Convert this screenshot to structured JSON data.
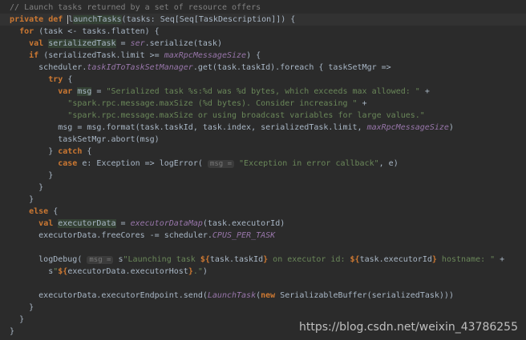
{
  "editor": {
    "lines": [
      [
        {
          "t": "  // Launch tasks returned by a set of resource offers",
          "c": "comment"
        }
      ],
      [
        {
          "t": "  ",
          "c": "plain"
        },
        {
          "t": "private def ",
          "c": "kw"
        },
        {
          "t": "l",
          "c": "plain caret"
        },
        {
          "t": "aunchTasks",
          "c": "plain hl"
        },
        {
          "t": "(tasks: Seq[Seq[TaskDescription]]) {",
          "c": "plain"
        }
      ],
      [
        {
          "t": "    ",
          "c": "plain"
        },
        {
          "t": "for ",
          "c": "kw"
        },
        {
          "t": "(task <- tasks.flatten) {",
          "c": "plain"
        }
      ],
      [
        {
          "t": "      ",
          "c": "plain"
        },
        {
          "t": "val ",
          "c": "kw"
        },
        {
          "t": "serializedTask",
          "c": "plain hl"
        },
        {
          "t": " = ",
          "c": "plain"
        },
        {
          "t": "ser",
          "c": "italic"
        },
        {
          "t": ".serialize(task)",
          "c": "plain"
        }
      ],
      [
        {
          "t": "      ",
          "c": "plain"
        },
        {
          "t": "if ",
          "c": "kw"
        },
        {
          "t": "(serializedTask.limit >= ",
          "c": "plain"
        },
        {
          "t": "maxRpcMessageSize",
          "c": "italic"
        },
        {
          "t": ") {",
          "c": "plain"
        }
      ],
      [
        {
          "t": "        scheduler.",
          "c": "plain"
        },
        {
          "t": "taskIdToTaskSetManager",
          "c": "italic"
        },
        {
          "t": ".get(task.taskId).foreach { taskSetMgr =>",
          "c": "plain"
        }
      ],
      [
        {
          "t": "          ",
          "c": "plain"
        },
        {
          "t": "try ",
          "c": "kw"
        },
        {
          "t": "{",
          "c": "plain"
        }
      ],
      [
        {
          "t": "            ",
          "c": "plain"
        },
        {
          "t": "var ",
          "c": "kw"
        },
        {
          "t": "msg",
          "c": "plain hl"
        },
        {
          "t": " = ",
          "c": "plain"
        },
        {
          "t": "\"Serialized task %s:%d was %d bytes, which exceeds max allowed: \"",
          "c": "str"
        },
        {
          "t": " +",
          "c": "plain"
        }
      ],
      [
        {
          "t": "              ",
          "c": "plain"
        },
        {
          "t": "\"spark.rpc.message.maxSize (%d bytes). Consider increasing \"",
          "c": "str"
        },
        {
          "t": " +",
          "c": "plain"
        }
      ],
      [
        {
          "t": "              ",
          "c": "plain"
        },
        {
          "t": "\"spark.rpc.message.maxSize or using broadcast variables for large values.\"",
          "c": "str"
        }
      ],
      [
        {
          "t": "            msg = msg.format(task.taskId, task.index, serializedTask.limit, ",
          "c": "plain"
        },
        {
          "t": "maxRpcMessageSize",
          "c": "italic"
        },
        {
          "t": ")",
          "c": "plain"
        }
      ],
      [
        {
          "t": "            taskSetMgr.abort(msg)",
          "c": "plain"
        }
      ],
      [
        {
          "t": "          } ",
          "c": "plain"
        },
        {
          "t": "catch ",
          "c": "kw"
        },
        {
          "t": "{",
          "c": "plain"
        }
      ],
      [
        {
          "t": "            ",
          "c": "plain"
        },
        {
          "t": "case ",
          "c": "kw"
        },
        {
          "t": "e: Exception => logError( ",
          "c": "plain"
        },
        {
          "t": "msg =",
          "c": "hint"
        },
        {
          "t": " ",
          "c": "plain"
        },
        {
          "t": "\"Exception in error callback\"",
          "c": "str"
        },
        {
          "t": ", e)",
          "c": "plain"
        }
      ],
      [
        {
          "t": "          }",
          "c": "plain"
        }
      ],
      [
        {
          "t": "        }",
          "c": "plain"
        }
      ],
      [
        {
          "t": "      }",
          "c": "plain"
        }
      ],
      [
        {
          "t": "      ",
          "c": "plain"
        },
        {
          "t": "else ",
          "c": "kw"
        },
        {
          "t": "{",
          "c": "plain"
        }
      ],
      [
        {
          "t": "        ",
          "c": "plain"
        },
        {
          "t": "val ",
          "c": "kw"
        },
        {
          "t": "executorData",
          "c": "plain hl"
        },
        {
          "t": " = ",
          "c": "plain"
        },
        {
          "t": "executorDataMap",
          "c": "italic"
        },
        {
          "t": "(task.executorId)",
          "c": "plain"
        }
      ],
      [
        {
          "t": "        executorData.freeCores -= scheduler.",
          "c": "plain"
        },
        {
          "t": "CPUS_PER_TASK",
          "c": "italic"
        }
      ],
      [],
      [
        {
          "t": "        logDebug( ",
          "c": "plain"
        },
        {
          "t": "msg =",
          "c": "hint"
        },
        {
          "t": " s",
          "c": "plain"
        },
        {
          "t": "\"Launching task ",
          "c": "str"
        },
        {
          "t": "${",
          "c": "kw"
        },
        {
          "t": "task.taskId",
          "c": "plain"
        },
        {
          "t": "}",
          "c": "kw"
        },
        {
          "t": " on executor id: ",
          "c": "str"
        },
        {
          "t": "${",
          "c": "kw"
        },
        {
          "t": "task.executorId",
          "c": "plain"
        },
        {
          "t": "}",
          "c": "kw"
        },
        {
          "t": " hostname: \"",
          "c": "str"
        },
        {
          "t": " +",
          "c": "plain"
        }
      ],
      [
        {
          "t": "          s",
          "c": "plain"
        },
        {
          "t": "\"",
          "c": "str"
        },
        {
          "t": "${",
          "c": "kw"
        },
        {
          "t": "executorData.executorHost",
          "c": "plain"
        },
        {
          "t": "}",
          "c": "kw"
        },
        {
          "t": ".\"",
          "c": "str"
        },
        {
          "t": ")",
          "c": "plain"
        }
      ],
      [],
      [
        {
          "t": "        executorData.executorEndpoint.send(",
          "c": "plain"
        },
        {
          "t": "LaunchTask",
          "c": "italic"
        },
        {
          "t": "(",
          "c": "plain"
        },
        {
          "t": "new ",
          "c": "kw"
        },
        {
          "t": "SerializableBuffer(serializedTask)))",
          "c": "plain"
        }
      ],
      [
        {
          "t": "      }",
          "c": "plain"
        }
      ],
      [
        {
          "t": "    }",
          "c": "plain"
        }
      ],
      [
        {
          "t": "  }",
          "c": "plain"
        }
      ]
    ],
    "current_line": 1
  },
  "watermark": "https://blog.csdn.net/weixin_43786255",
  "colors": {
    "background": "#2b2b2b",
    "keyword": "#cc7832",
    "string": "#6a8759",
    "comment": "#808080",
    "field": "#9876aa",
    "plain": "#a9b7c6"
  }
}
